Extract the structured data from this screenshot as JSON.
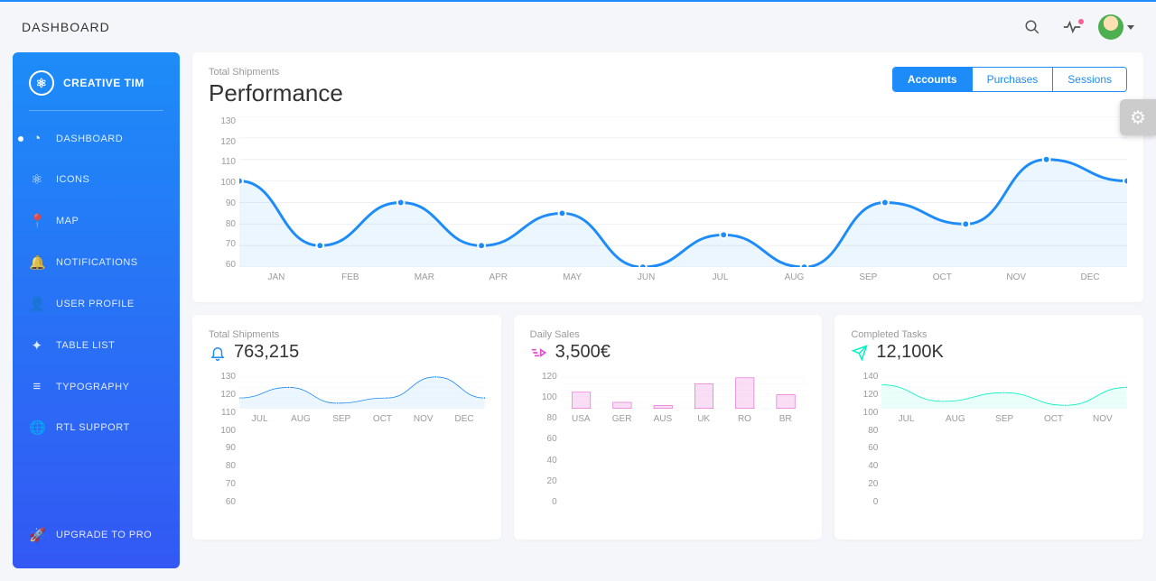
{
  "header": {
    "title": "DASHBOARD"
  },
  "sidebar": {
    "brand": "CREATIVE TIM",
    "items": [
      {
        "label": "DASHBOARD",
        "icon": "◔"
      },
      {
        "label": "ICONS",
        "icon": "⚛"
      },
      {
        "label": "MAP",
        "icon": "📍"
      },
      {
        "label": "NOTIFICATIONS",
        "icon": "🔔"
      },
      {
        "label": "USER PROFILE",
        "icon": "👤"
      },
      {
        "label": "TABLE LIST",
        "icon": "✦"
      },
      {
        "label": "TYPOGRAPHY",
        "icon": "≡"
      },
      {
        "label": "RTL SUPPORT",
        "icon": "🌐"
      }
    ],
    "upgrade": "UPGRADE TO PRO"
  },
  "perf_card": {
    "subtitle": "Total Shipments",
    "title": "Performance",
    "tabs": [
      "Accounts",
      "Purchases",
      "Sessions"
    ]
  },
  "small_cards": {
    "shipments": {
      "subtitle": "Total Shipments",
      "value": "763,215"
    },
    "sales": {
      "subtitle": "Daily Sales",
      "value": "3,500€"
    },
    "tasks": {
      "subtitle": "Completed Tasks",
      "value": "12,100K"
    }
  },
  "colors": {
    "blue": "#1d8cf8",
    "pink": "#e14eca",
    "teal": "#00f2c3"
  },
  "chart_data": [
    {
      "id": "performance",
      "type": "line",
      "title": "Performance",
      "ylabel": "",
      "ylim": [
        60,
        130
      ],
      "yticks": [
        60,
        70,
        80,
        90,
        100,
        110,
        120,
        130
      ],
      "categories": [
        "JAN",
        "FEB",
        "MAR",
        "APR",
        "MAY",
        "JUN",
        "JUL",
        "AUG",
        "SEP",
        "OCT",
        "NOV",
        "DEC"
      ],
      "values": [
        100,
        70,
        90,
        70,
        85,
        60,
        75,
        60,
        90,
        80,
        110,
        100
      ]
    },
    {
      "id": "shipments_small",
      "type": "line",
      "ylim": [
        60,
        130
      ],
      "yticks": [
        60,
        70,
        80,
        90,
        100,
        110,
        120,
        130
      ],
      "categories": [
        "JUL",
        "AUG",
        "SEP",
        "OCT",
        "NOV",
        "DEC"
      ],
      "values": [
        80,
        100,
        70,
        80,
        120,
        80
      ]
    },
    {
      "id": "daily_sales",
      "type": "bar",
      "ylim": [
        0,
        120
      ],
      "yticks": [
        0,
        20,
        40,
        60,
        80,
        100,
        120
      ],
      "categories": [
        "USA",
        "GER",
        "AUS",
        "UK",
        "RO",
        "BR"
      ],
      "values": [
        53,
        20,
        10,
        80,
        100,
        45
      ]
    },
    {
      "id": "completed_tasks",
      "type": "line",
      "ylim": [
        0,
        140
      ],
      "yticks": [
        0,
        20,
        40,
        60,
        80,
        100,
        120,
        140
      ],
      "categories": [
        "JUL",
        "AUG",
        "SEP",
        "OCT",
        "NOV"
      ],
      "values": [
        90,
        27,
        60,
        12,
        80
      ]
    }
  ]
}
